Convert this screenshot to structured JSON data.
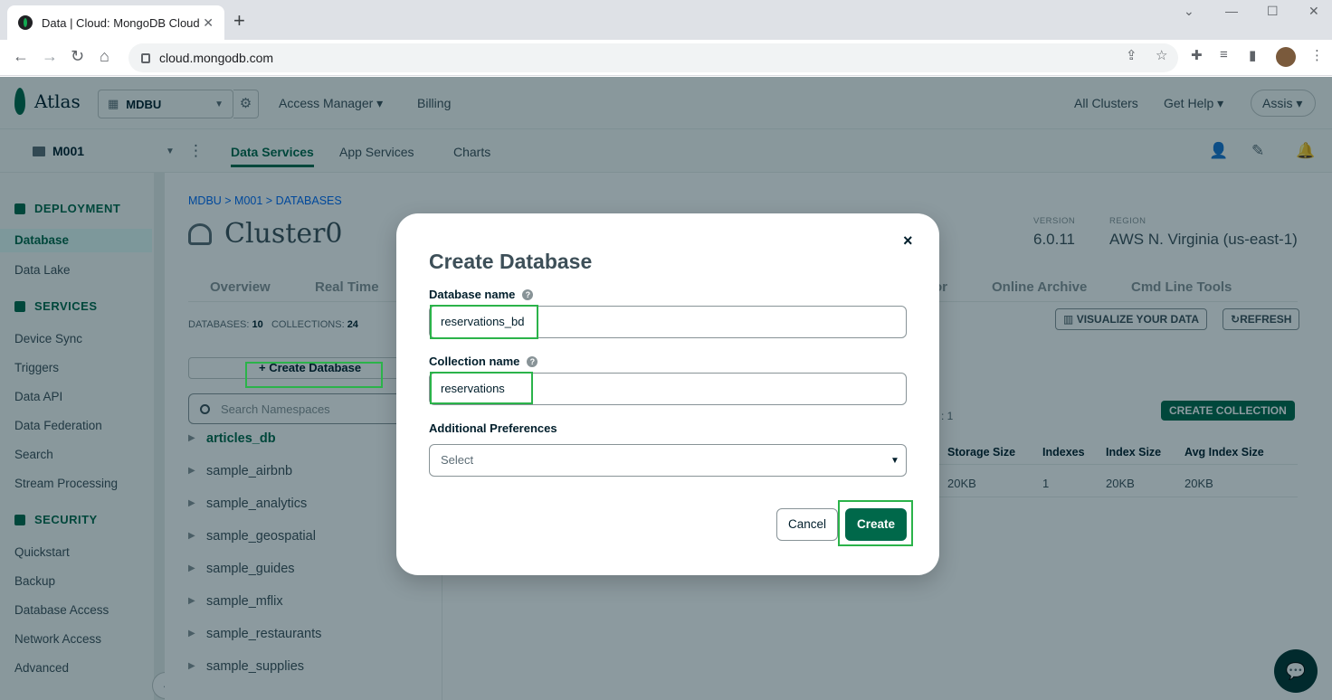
{
  "browser": {
    "tab_title": "Data | Cloud: MongoDB Cloud",
    "url": "cloud.mongodb.com",
    "win_minimize": "—",
    "win_maximize": "☐",
    "win_close": "✕"
  },
  "topnav": {
    "logo": "Atlas",
    "org": "MDBU",
    "access_manager": "Access Manager",
    "billing": "Billing",
    "all_clusters": "All Clusters",
    "get_help": "Get Help",
    "user": "Assis"
  },
  "subnav": {
    "project": "M001",
    "data_services": "Data Services",
    "app_services": "App Services",
    "charts": "Charts"
  },
  "sidebar": {
    "deployment": "DEPLOYMENT",
    "database": "Database",
    "data_lake": "Data Lake",
    "services": "SERVICES",
    "device_sync": "Device Sync",
    "triggers": "Triggers",
    "data_api": "Data API",
    "data_federation": "Data Federation",
    "search": "Search",
    "stream_processing": "Stream Processing",
    "security": "SECURITY",
    "quickstart": "Quickstart",
    "backup": "Backup",
    "database_access": "Database Access",
    "network_access": "Network Access",
    "advanced": "Advanced"
  },
  "main": {
    "breadcrumb": "MDBU > M001 > DATABASES",
    "cluster_name": "Cluster0",
    "version_label": "VERSION",
    "version_value": "6.0.11",
    "region_label": "REGION",
    "region_value": "AWS N. Virginia (us-east-1)",
    "tabs": [
      "Overview",
      "Real Time",
      "or",
      "Online Archive",
      "Cmd Line Tools"
    ],
    "databases_label": "DATABASES:",
    "databases_count": "10",
    "collections_label": "COLLECTIONS:",
    "collections_count": "24",
    "visualize": "VISUALIZE YOUR DATA",
    "refresh": "REFRESH",
    "create_database": "+ Create Database",
    "search_placeholder": "Search Namespaces",
    "databases": [
      "articles_db",
      "sample_airbnb",
      "sample_analytics",
      "sample_geospatial",
      "sample_guides",
      "sample_mflix",
      "sample_restaurants",
      "sample_supplies"
    ],
    "partial_text": ": 1",
    "create_collection": "CREATE COLLECTION",
    "table_headers": [
      "Storage Size",
      "Indexes",
      "Index Size",
      "Avg Index Size"
    ],
    "table_row": [
      "20KB",
      "1",
      "20KB",
      "20KB"
    ]
  },
  "modal": {
    "title": "Create Database",
    "db_name_label": "Database name",
    "db_name_value": "reservations_bd",
    "coll_name_label": "Collection name",
    "coll_name_value": "reservations",
    "prefs_label": "Additional Preferences",
    "prefs_value": "Select",
    "cancel": "Cancel",
    "create": "Create",
    "close": "×"
  },
  "colors": {
    "accent": "#00684a",
    "highlight": "#2bb34a"
  }
}
